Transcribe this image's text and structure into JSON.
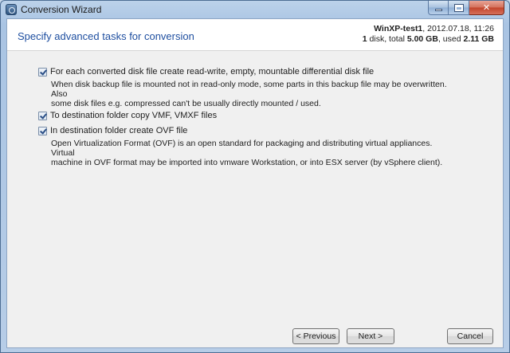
{
  "window": {
    "title": "Conversion Wizard",
    "icon": "app-icon"
  },
  "header": {
    "title": "Specify advanced tasks for conversion",
    "host_name": "WinXP-test1",
    "host_date": ", 2012.07.18,  11:26",
    "disk_count": "1",
    "disk_total_prefix": " disk, total ",
    "disk_total": "5.00 GB",
    "disk_used_prefix": ", used ",
    "disk_used": "2.11 GB"
  },
  "options": [
    {
      "label": "For each converted disk file create read-write, empty, mountable differential disk file",
      "checked": true,
      "description_lines": [
        "When disk backup file is mounted not in read-only mode, some parts in this backup file may be overwritten. Also",
        "some disk files e.g. compressed can't be usually directly mounted / used."
      ]
    },
    {
      "label": "To destination folder copy VMF, VMXF files",
      "checked": true
    },
    {
      "label": "In destination folder create OVF file",
      "checked": true,
      "description_lines": [
        "Open Virtualization Format (OVF) is an open standard for packaging and distributing virtual appliances. Virtual",
        "machine in OVF format may be imported into vmware Workstation, or into ESX server (by vSphere client)."
      ]
    }
  ],
  "buttons": {
    "previous": "< Previous",
    "next": "Next >",
    "cancel": "Cancel"
  }
}
